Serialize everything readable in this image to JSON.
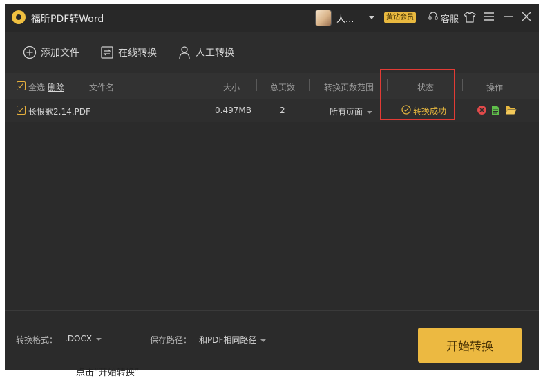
{
  "window": {
    "title": "福昕PDF转Word",
    "user_name": "人...",
    "vip_badge": "黄钻会员",
    "support_label": "客服"
  },
  "toolbar": {
    "add_file": "添加文件",
    "online_convert": "在线转换",
    "manual_convert": "人工转换"
  },
  "table": {
    "headers": {
      "select_all": "全选",
      "delete": "删除",
      "file_name": "文件名",
      "size": "大小",
      "total_pages": "总页数",
      "page_range": "转换页数范围",
      "status": "状态",
      "actions": "操作"
    },
    "rows": [
      {
        "file_name": "长恨歌2.14.PDF",
        "size": "0.497MB",
        "pages": "2",
        "page_range": "所有页面",
        "status": "转换成功"
      }
    ]
  },
  "footer": {
    "format_label": "转换格式：",
    "format_value": ".DOCX",
    "path_label": "保存路径：",
    "path_value": "和PDF相同路径",
    "start_button": "开始转换"
  },
  "caption": "点击“开始转换”",
  "colors": {
    "accent": "#e9b93f",
    "highlight": "#e23b35",
    "window_bg": "#2b2b2b"
  }
}
